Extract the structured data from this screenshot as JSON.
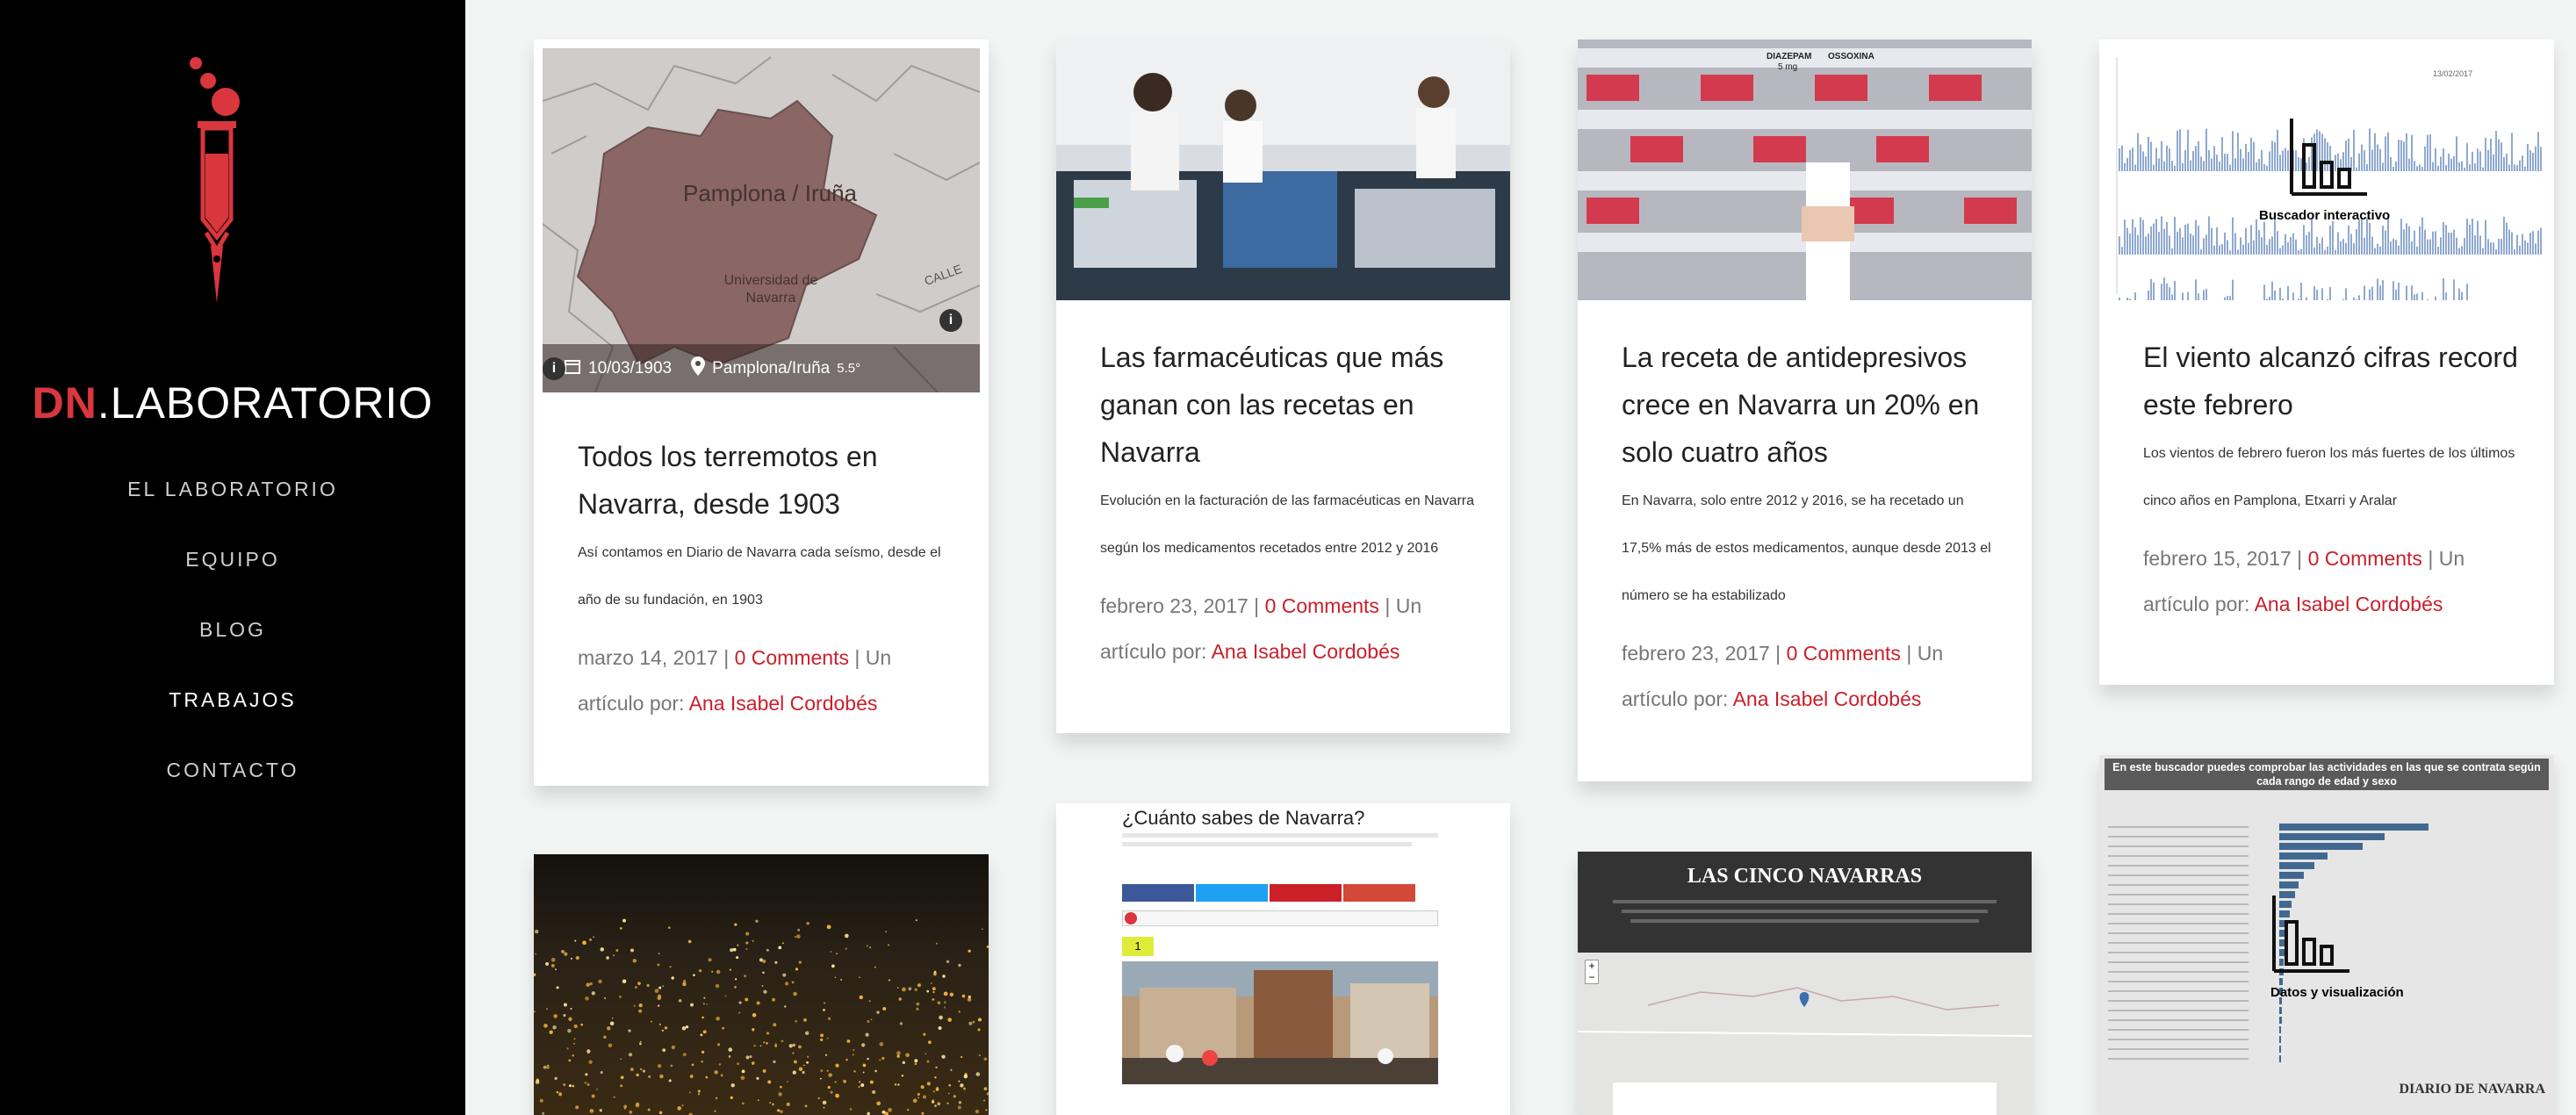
{
  "brand": {
    "prefix": "DN",
    "suffix": ".LABORATORIO"
  },
  "colors": {
    "accent": "#d9363e",
    "link": "#c9202b",
    "sidebar": "#000000"
  },
  "nav": [
    {
      "label": "EL LABORATORIO",
      "active": false
    },
    {
      "label": "EQUIPO",
      "active": false
    },
    {
      "label": "BLOG",
      "active": false
    },
    {
      "label": "TRABAJOS",
      "active": true
    },
    {
      "label": "CONTACTO",
      "active": false
    }
  ],
  "posts": [
    {
      "title": "Todos los terremotos en Navarra, desde 1903",
      "excerpt": "Así contamos en Diario de Navarra cada seísmo, desde el año de su fundación, en 1903",
      "date": "marzo 14, 2017",
      "comments": "0 Comments",
      "by": "Un artículo por:",
      "author": "Ana Isabel Cordobés",
      "thumb": {
        "date": "10/03/1903",
        "place": "Pamplona/Iruña",
        "magnitude": "5.5°",
        "map_city": "Pamplona / Iruña",
        "map_sub": "Universidad de Navarra",
        "street": "CALLE"
      }
    },
    {
      "title": "Las farmacéuticas que más ganan con las recetas en Navarra",
      "excerpt": "Evolución en la facturación de las farmacéuticas en Navarra según los medicamentos recetados entre 2012 y 2016",
      "date": "febrero 23, 2017",
      "comments": "0 Comments",
      "by": "Un artículo por:",
      "author": "Ana Isabel Cordobés"
    },
    {
      "title": "La receta de antidepresivos crece en Navarra un 20% en solo cuatro años",
      "excerpt": "En Navarra, solo entre 2012 y 2016, se ha recetado un 17,5% más de estos medicamentos, aunque desde 2013 el número se ha estabilizado",
      "date": "febrero 23, 2017",
      "comments": "0 Comments",
      "by": "Un artículo por:",
      "author": "Ana Isabel Cordobés",
      "thumb": {
        "labels": [
          "DIAZEPAM",
          "5 mg",
          "OSSOXINA"
        ]
      }
    },
    {
      "title": "El viento alcanzó cifras record este febrero",
      "excerpt": "Los vientos de febrero fueron los más fuertes de los últimos cinco años en Pamplona, Etxarri y Aralar",
      "date": "febrero 15, 2017",
      "comments": "0 Comments",
      "by": "Un artículo por:",
      "author": "Ana Isabel Cordobés",
      "thumb": {
        "overlay": "Buscador interactivo",
        "date": "13/02/2017"
      }
    }
  ],
  "quiz": {
    "title": "¿Cuánto sabes de Navarra?",
    "step": "1"
  },
  "navarras": {
    "title": "LAS CINCO NAVARRAS"
  },
  "dataviz": {
    "title": "En este buscador puedes comprobar las actividades en las que se contrata según cada rango de edad y sexo",
    "overlay": "Datos y visualización",
    "brand": "DIARIO DE NAVARRA"
  }
}
